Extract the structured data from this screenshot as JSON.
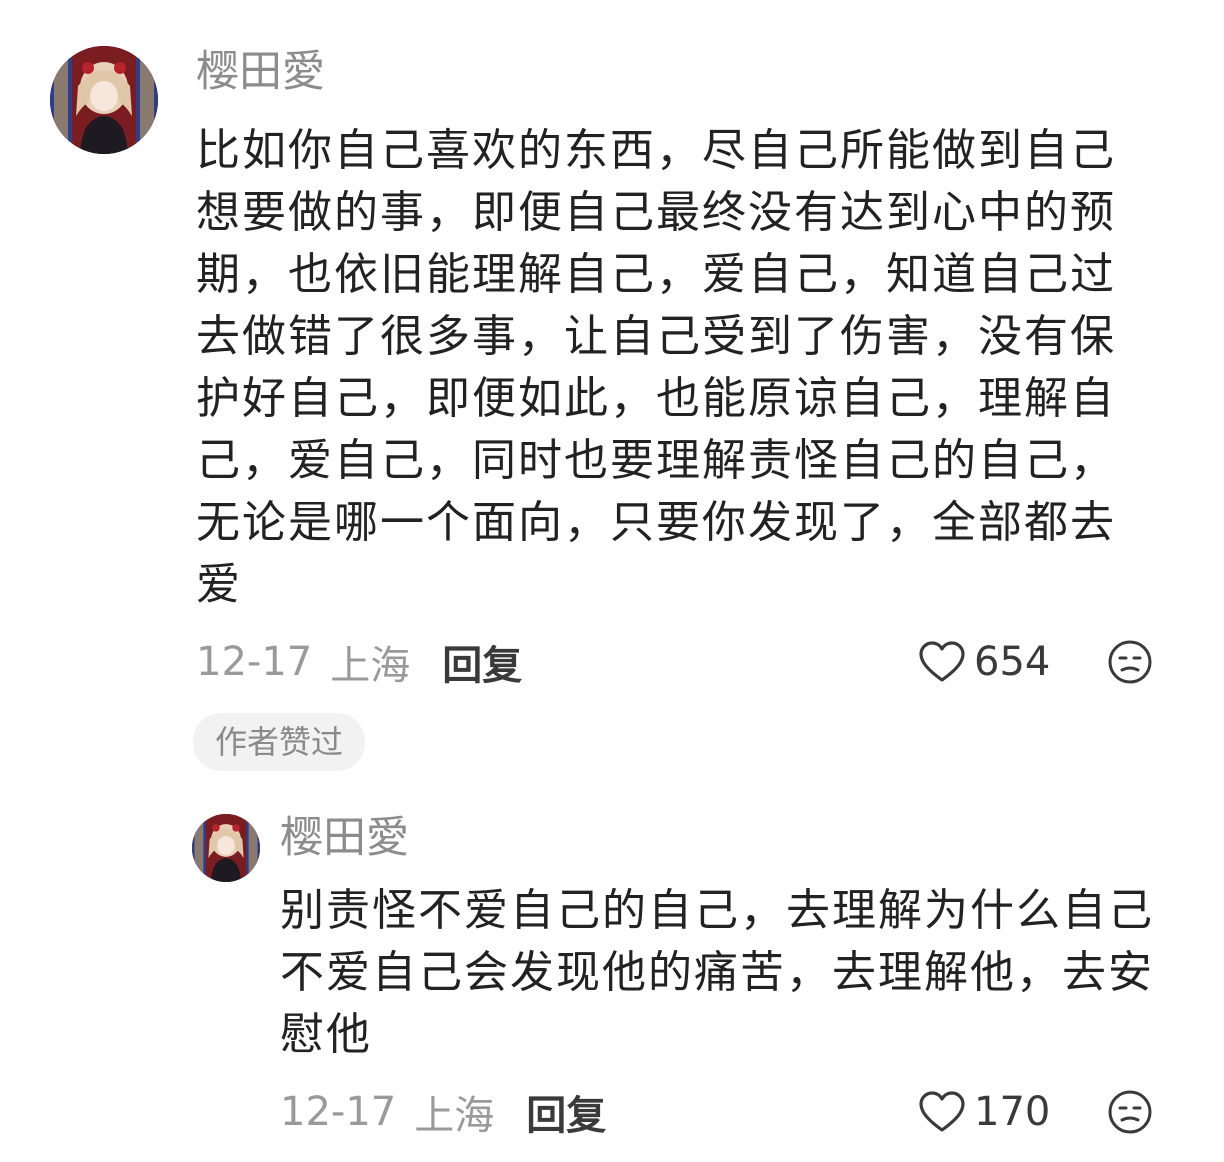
{
  "comment": {
    "username": "樱田愛",
    "text": "比如你自己喜欢的东西，尽自己所能做到自己想要做的事，即便自己最终没有达到心中的预期，也依旧能理解自己，爱自己，知道自己过去做错了很多事，让自己受到了伤害，没有保护好自己，即便如此，也能原谅自己，理解自己，爱自己，同时也要理解责怪自己的自己，无论是哪一个面向，只要你发现了，全部都去爱",
    "date": "12-17",
    "location": "上海",
    "reply_label": "回复",
    "like_count": "654",
    "author_badge": "作者赞过",
    "icons": {
      "like": "heart-outline-icon",
      "dislike": "unhappy-face-icon"
    }
  },
  "reply": {
    "username": "樱田愛",
    "text": "别责怪不爱自己的自己，去理解为什么自己不爱自己会发现他的痛苦，去理解他，去安慰他",
    "date": "12-17",
    "location": "上海",
    "reply_label": "回复",
    "like_count": "170",
    "icons": {
      "like": "heart-outline-icon",
      "dislike": "unhappy-face-icon"
    }
  },
  "colors": {
    "username": "#8c8c8c",
    "body_text": "#222222",
    "meta_text": "#9a9a9a",
    "badge_bg": "#f2f2f2"
  }
}
